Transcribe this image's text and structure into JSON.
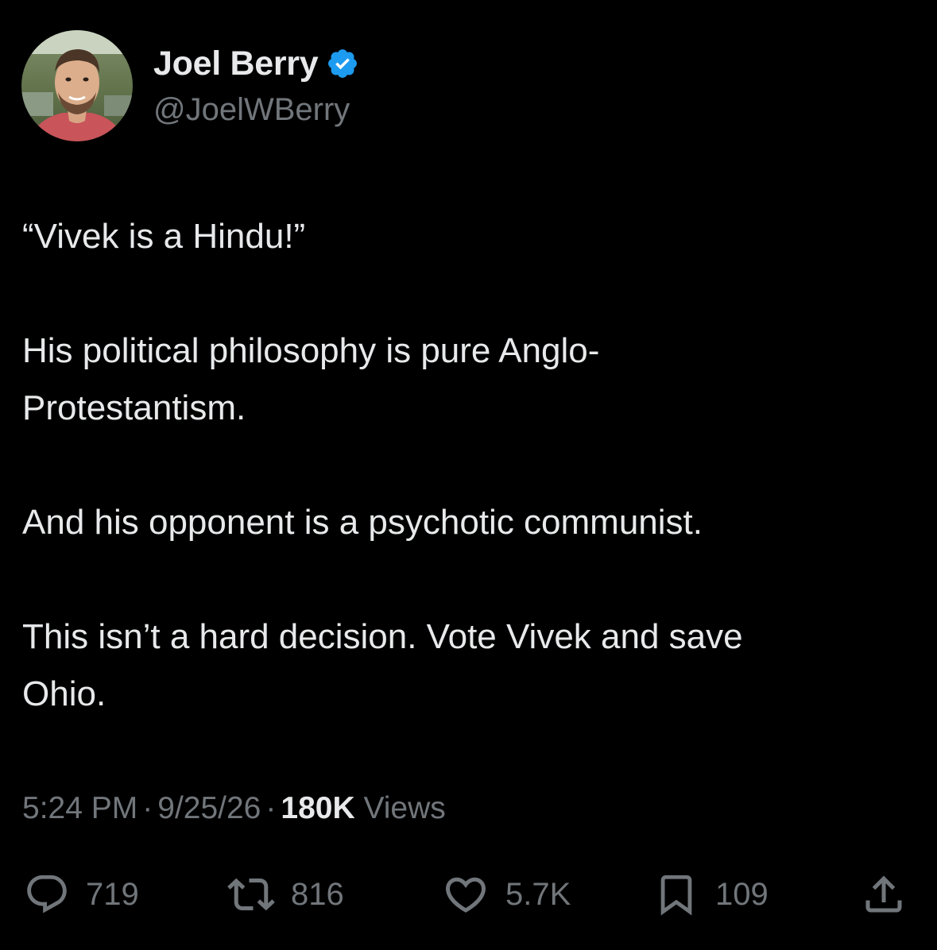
{
  "author": {
    "display_name": "Joel Berry",
    "handle": "@JoelWBerry",
    "verified": true,
    "verified_color": "#1d9bf0"
  },
  "tweet": {
    "paragraphs": [
      "“Vivek is a Hindu!”",
      "His political philosophy is pure Anglo-\nProtestantism.",
      "And his opponent is a psychotic communist.",
      "This isn’t a hard decision. Vote Vivek and save\nOhio."
    ]
  },
  "meta": {
    "time": "5:24 PM",
    "separator": "·",
    "date": "9/25/26",
    "views_count": "180K",
    "views_label": "Views"
  },
  "actions": {
    "replies": {
      "icon": "reply-icon",
      "count": "719"
    },
    "reposts": {
      "icon": "repost-icon",
      "count": "816"
    },
    "likes": {
      "icon": "like-icon",
      "count": "5.7K"
    },
    "bookmarks": {
      "icon": "bookmark-icon",
      "count": "109"
    },
    "share": {
      "icon": "share-icon"
    }
  },
  "colors": {
    "background": "#000000",
    "text_primary": "#e7e9ea",
    "text_secondary": "#71767b",
    "icon": "#71767b"
  }
}
